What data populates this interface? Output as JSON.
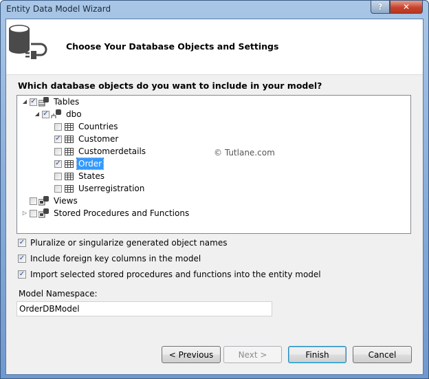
{
  "window": {
    "title": "Entity Data Model Wizard",
    "help_label": "?",
    "close_label": "✕"
  },
  "header": {
    "icon": "database-plug-icon",
    "title": "Choose Your Database Objects and Settings"
  },
  "question": "Which database objects do you want to include in your model?",
  "tree": {
    "tables": {
      "label": "Tables",
      "checked": true,
      "expanded": true
    },
    "dbo": {
      "label": "dbo",
      "checked": true,
      "expanded": true
    },
    "tables_list": [
      {
        "label": "Countries",
        "checked": false,
        "selected": false
      },
      {
        "label": "Customer",
        "checked": true,
        "selected": false
      },
      {
        "label": "Customerdetails",
        "checked": false,
        "selected": false
      },
      {
        "label": "Order",
        "checked": true,
        "selected": true
      },
      {
        "label": "States",
        "checked": false,
        "selected": false
      },
      {
        "label": "Userregistration",
        "checked": false,
        "selected": false
      }
    ],
    "views": {
      "label": "Views",
      "checked": false
    },
    "stored_procedures": {
      "label": "Stored Procedures and Functions",
      "checked": false,
      "expanded": false
    }
  },
  "watermark": "© Tutlane.com",
  "options": [
    {
      "label": "Pluralize or singularize generated object names",
      "checked": true
    },
    {
      "label": "Include foreign key columns in the model",
      "checked": true
    },
    {
      "label": "Import selected stored procedures and functions into the entity model",
      "checked": true
    }
  ],
  "namespace": {
    "label": "Model Namespace:",
    "value": "OrderDBModel"
  },
  "buttons": {
    "previous": "< Previous",
    "next": "Next >",
    "finish": "Finish",
    "cancel": "Cancel"
  },
  "check_glyph": "✓"
}
